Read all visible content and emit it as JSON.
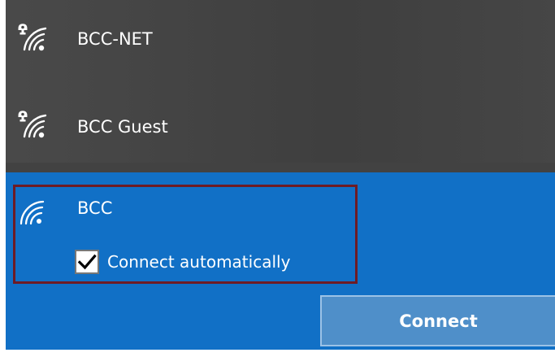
{
  "networks": [
    {
      "name": "BCC-NET",
      "secured": true,
      "icon": "wifi-secured-icon"
    },
    {
      "name": "BCC Guest",
      "secured": true,
      "icon": "wifi-secured-icon"
    }
  ],
  "selected_network": {
    "name": "BCC",
    "icon": "wifi-icon",
    "connect_automatically": {
      "label": "Connect automatically",
      "checked": true
    },
    "connect_button_label": "Connect"
  },
  "colors": {
    "panel_bg": "#424242",
    "selected_bg": "#1170c6",
    "highlight_border": "#6e1b24",
    "button_bg": "#4f8fc9",
    "text": "#ffffff"
  }
}
